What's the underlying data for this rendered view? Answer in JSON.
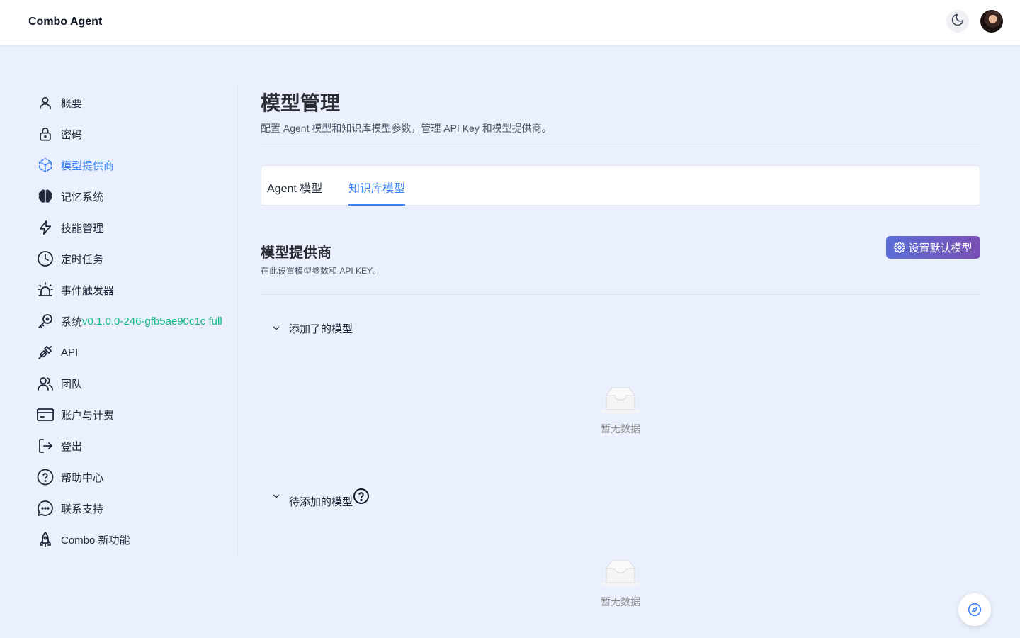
{
  "app": {
    "title": "Combo Agent"
  },
  "header": {
    "theme_icon": "moon-icon",
    "avatar_alt": "user avatar"
  },
  "sidebar": {
    "items": [
      {
        "label": "概要",
        "icon": "user-icon"
      },
      {
        "label": "密码",
        "icon": "lock-icon"
      },
      {
        "label": "模型提供商",
        "icon": "cube-icon",
        "active": true
      },
      {
        "label": "记忆系统",
        "icon": "brain-icon"
      },
      {
        "label": "技能管理",
        "icon": "lightning-icon"
      },
      {
        "label": "定时任务",
        "icon": "clock-icon"
      },
      {
        "label": "事件触发器",
        "icon": "alarm-icon"
      },
      {
        "label": "系统",
        "icon": "key-icon",
        "version": "v0.1.0.0-246-gfb5ae90c1c full"
      },
      {
        "label": "API",
        "icon": "plug-icon"
      },
      {
        "label": "团队",
        "icon": "users-icon"
      },
      {
        "label": "账户与计费",
        "icon": "credit-card-icon"
      },
      {
        "label": "登出",
        "icon": "logout-icon"
      },
      {
        "label": "帮助中心",
        "icon": "question-icon"
      },
      {
        "label": "联系支持",
        "icon": "chat-icon"
      },
      {
        "label": "Combo 新功能",
        "icon": "rocket-icon"
      }
    ]
  },
  "main": {
    "title": "模型管理",
    "description": "配置 Agent 模型和知识库模型参数，管理 API Key 和模型提供商。",
    "tabs": [
      {
        "label": "Agent 模型",
        "active": false
      },
      {
        "label": "知识库模型",
        "active": true
      }
    ],
    "section": {
      "title": "模型提供商",
      "description": "在此设置模型参数和 API KEY。",
      "default_button": "设置默认模型"
    },
    "groups": [
      {
        "title": "添加了的模型",
        "empty_text": "暂无数据"
      },
      {
        "title": "待添加的模型",
        "empty_text": "暂无数据"
      }
    ]
  },
  "colors": {
    "accent": "#3b82f6",
    "version": "#10b981",
    "background": "#eaf0fd"
  }
}
